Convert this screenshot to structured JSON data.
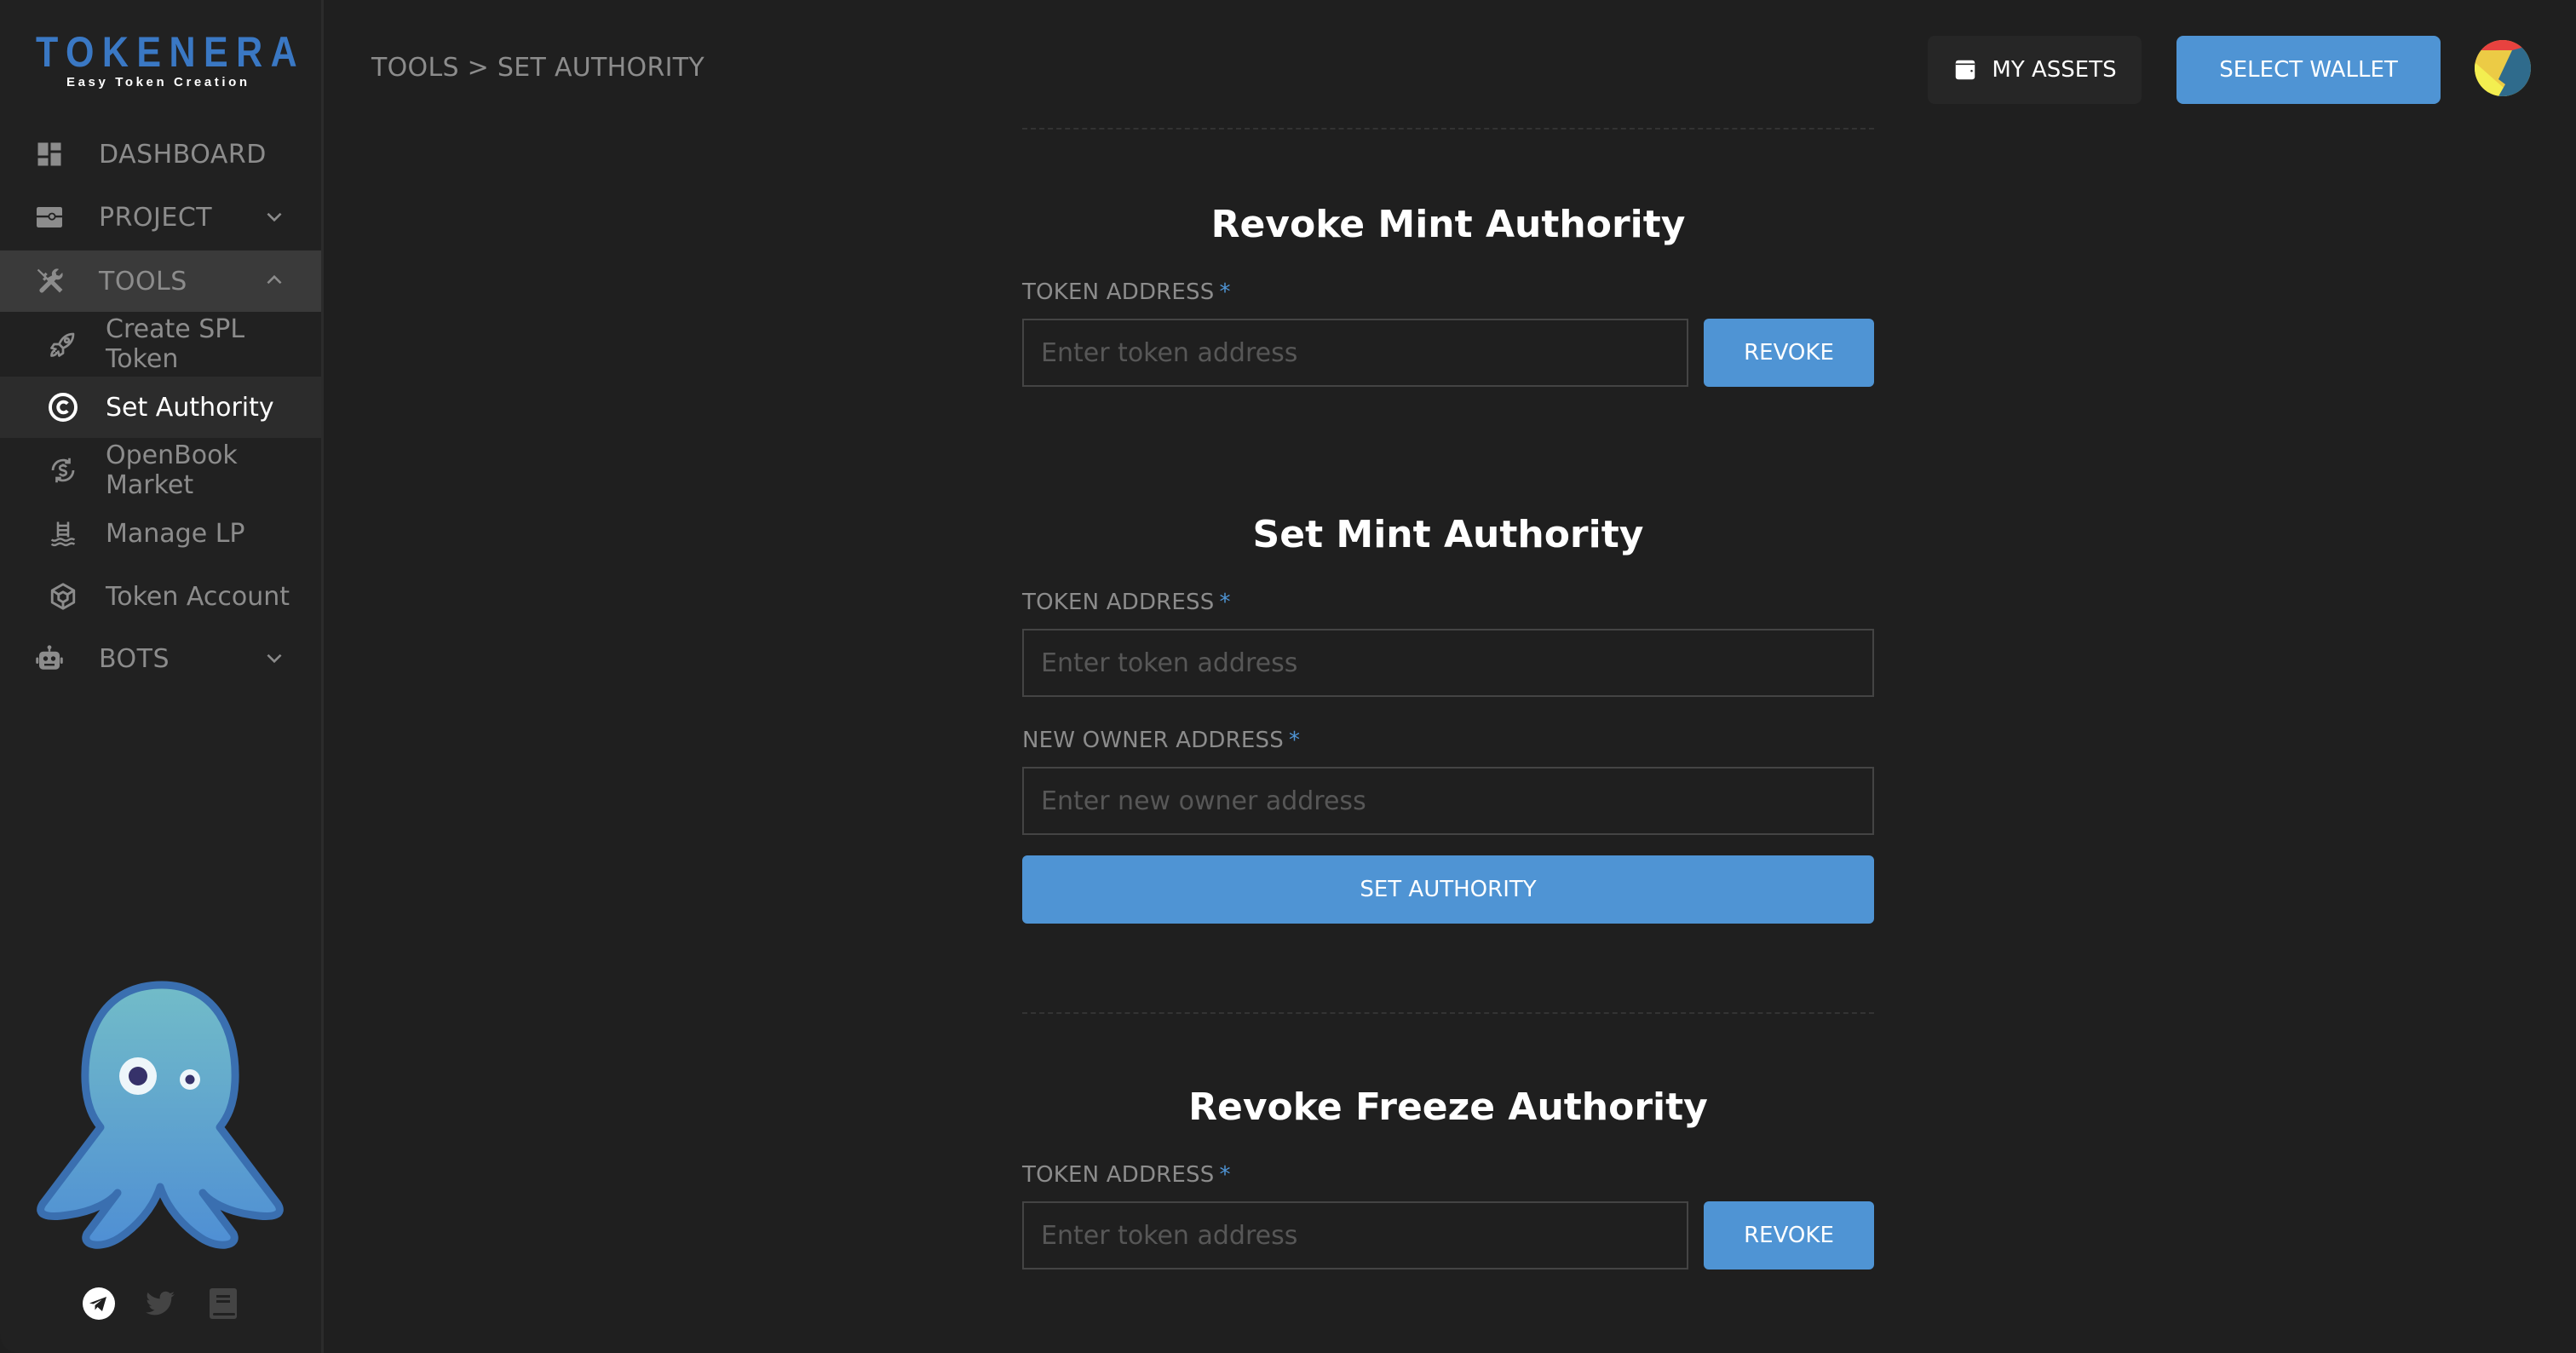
{
  "brand": {
    "name": "TOKENERA",
    "tagline": "Easy Token Creation"
  },
  "sidebar": {
    "items": [
      {
        "label": "DASHBOARD",
        "icon": "dashboard-icon"
      },
      {
        "label": "PROJECT",
        "icon": "project-icon",
        "expandable": true,
        "expanded": false
      },
      {
        "label": "TOOLS",
        "icon": "tools-icon",
        "expandable": true,
        "expanded": true
      },
      {
        "label": "Create SPL Token",
        "icon": "rocket-icon",
        "sub": true
      },
      {
        "label": "Set Authority",
        "icon": "copyright-icon",
        "sub": true,
        "active": true
      },
      {
        "label": "OpenBook Market",
        "icon": "dollar-cycle-icon",
        "sub": true
      },
      {
        "label": "Manage LP",
        "icon": "pool-icon",
        "sub": true
      },
      {
        "label": "Token Account",
        "icon": "cube-icon",
        "sub": true
      },
      {
        "label": "BOTS",
        "icon": "robot-icon",
        "expandable": true,
        "expanded": false
      }
    ],
    "social": [
      "telegram-icon",
      "twitter-icon",
      "docs-book-icon"
    ]
  },
  "header": {
    "breadcrumb": "TOOLS > SET AUTHORITY",
    "my_assets_label": "MY ASSETS",
    "select_wallet_label": "SELECT WALLET"
  },
  "sections": {
    "revoke_mint": {
      "title": "Revoke Mint Authority",
      "token_label": "TOKEN ADDRESS",
      "required_mark": "*",
      "token_placeholder": "Enter token address",
      "token_value": "",
      "button_label": "REVOKE"
    },
    "set_mint": {
      "title": "Set Mint Authority",
      "token_label": "TOKEN ADDRESS",
      "required_mark": "*",
      "token_placeholder": "Enter token address",
      "token_value": "",
      "owner_label": "NEW OWNER ADDRESS",
      "owner_placeholder": "Enter new owner address",
      "owner_value": "",
      "button_label": "SET AUTHORITY"
    },
    "revoke_freeze": {
      "title": "Revoke Freeze Authority",
      "token_label": "TOKEN ADDRESS",
      "required_mark": "*",
      "token_placeholder": "Enter token address",
      "token_value": "",
      "button_label": "REVOKE"
    }
  },
  "colors": {
    "accent": "#4f94d4",
    "brand_blue": "#3a78c4",
    "background": "#1f1f1f",
    "sidebar_bg": "#212121",
    "muted_text": "#8c8c8c"
  }
}
